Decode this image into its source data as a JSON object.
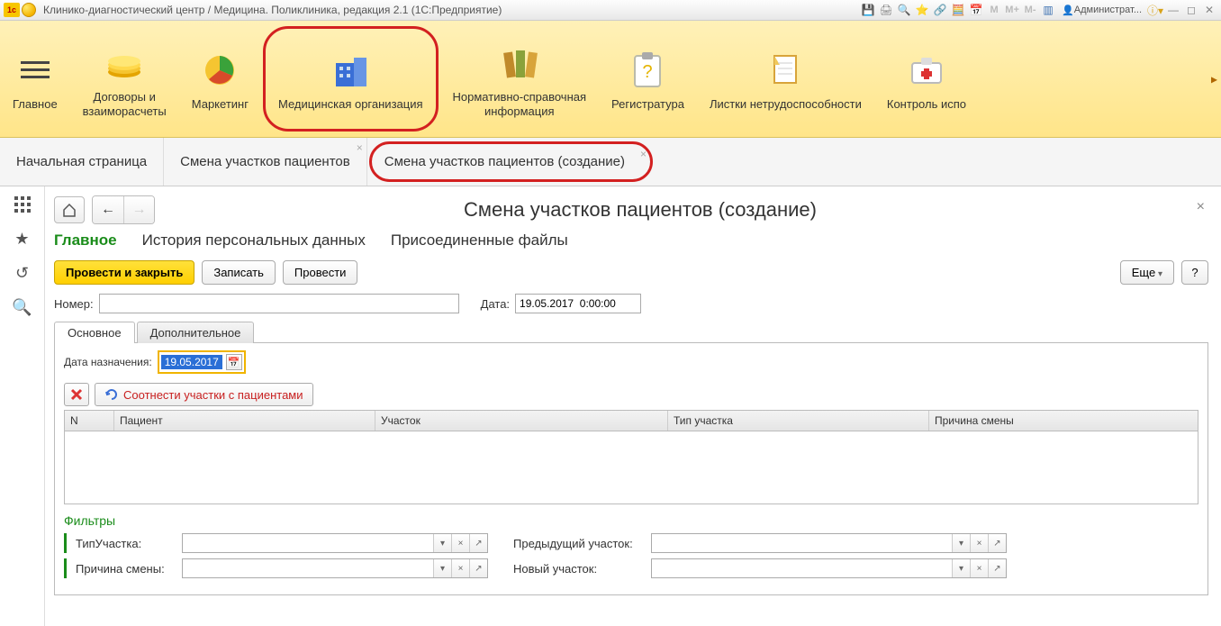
{
  "titlebar": {
    "title": "Клинико-диагностический центр / Медицина. Поликлиника, редакция 2.1  (1С:Предприятие)",
    "user": "Администрат...",
    "m_labels": [
      "M",
      "M+",
      "M-"
    ]
  },
  "maintoolbar": {
    "items": [
      {
        "label": "Главное"
      },
      {
        "label": "Договоры и\nвзаиморасчеты"
      },
      {
        "label": "Маркетинг"
      },
      {
        "label": "Медицинская организация",
        "highlight": true
      },
      {
        "label": "Нормативно-справочная\nинформация"
      },
      {
        "label": "Регистратура"
      },
      {
        "label": "Листки нетрудоспособности"
      },
      {
        "label": "Контроль испо"
      }
    ]
  },
  "tabs": [
    {
      "label": "Начальная страница"
    },
    {
      "label": "Смена участков пациентов",
      "closable": true
    },
    {
      "label": "Смена участков пациентов (создание)",
      "closable": true,
      "highlight": true
    }
  ],
  "page": {
    "title": "Смена участков пациентов (создание)",
    "subnav": {
      "main": "Главное",
      "history": "История персональных данных",
      "files": "Присоединенные файлы"
    },
    "buttons": {
      "post_close": "Провести и закрыть",
      "save": "Записать",
      "post": "Провести",
      "more": "Еще",
      "help": "?"
    },
    "fields": {
      "number_label": "Номер:",
      "number_value": "",
      "date_label": "Дата:",
      "date_value": "19.05.2017  0:00:00"
    },
    "inner_tabs": {
      "main": "Основное",
      "extra": "Дополнительное"
    },
    "assign_date_label": "Дата назначения:",
    "assign_date_value": "19.05.2017",
    "correlate_btn": "Соотнести участки с пациентами",
    "grid_headers": {
      "n": "N",
      "patient": "Пациент",
      "area": "Участок",
      "area_type": "Тип участка",
      "reason": "Причина смены"
    },
    "filters": {
      "title": "Фильтры",
      "area_type": "ТипУчастка:",
      "reason": "Причина смены:",
      "prev_area": "Предыдущий участок:",
      "new_area": "Новый участок:"
    }
  }
}
